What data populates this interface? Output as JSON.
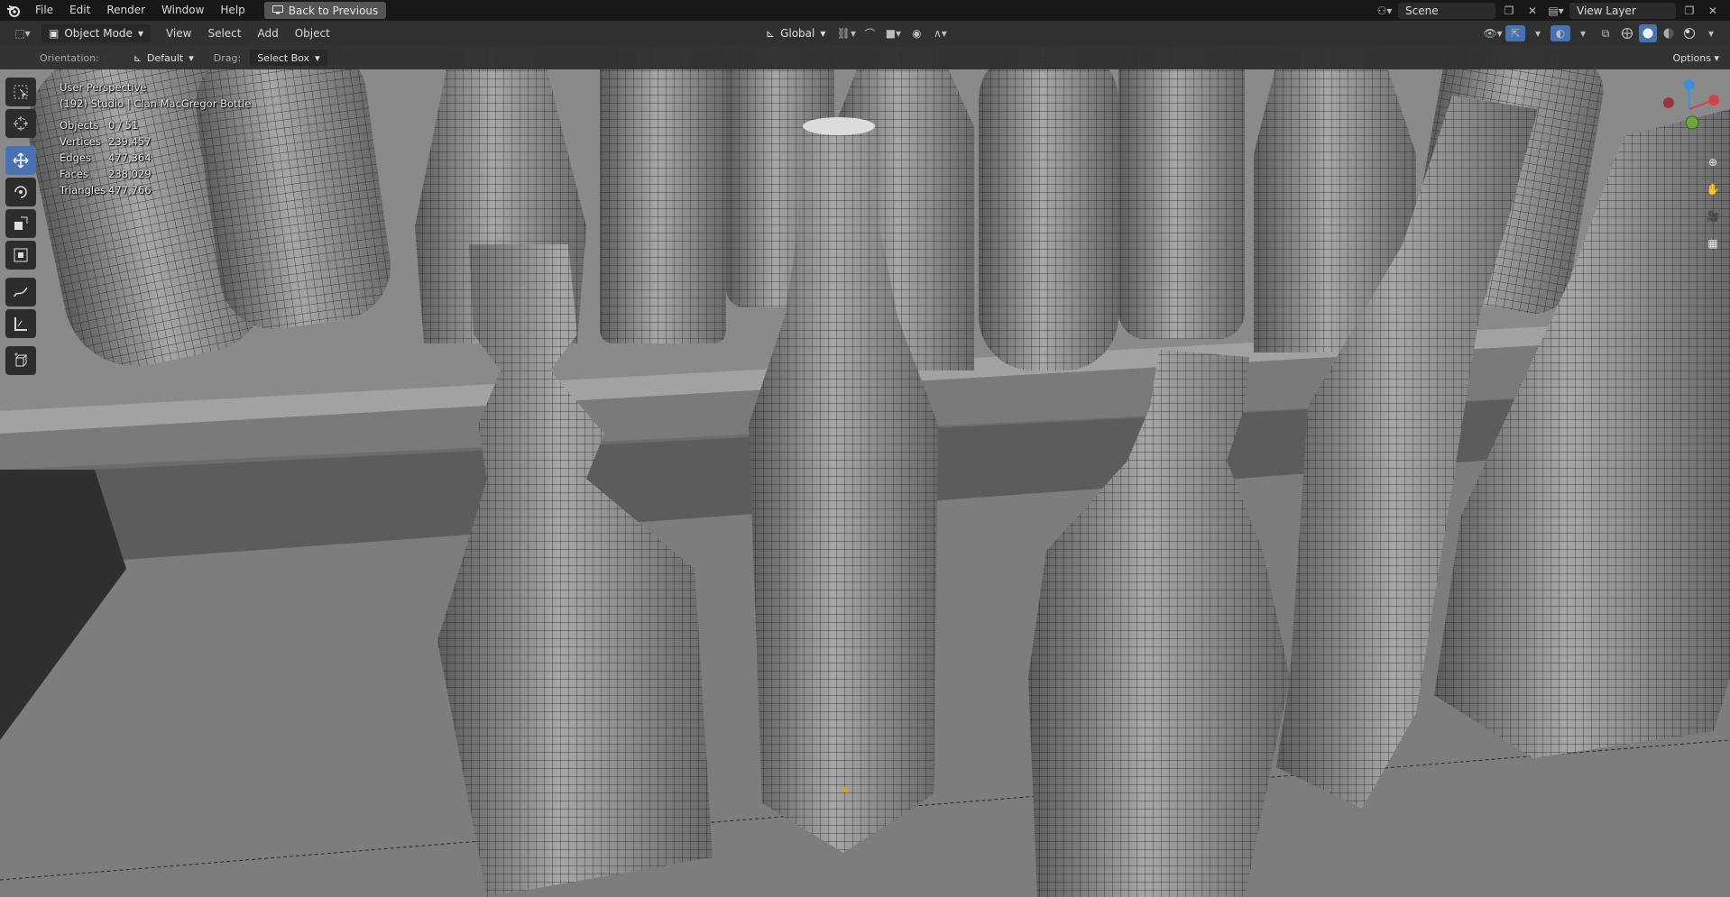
{
  "menubar": {
    "items": [
      "File",
      "Edit",
      "Render",
      "Window",
      "Help"
    ],
    "back_label": "Back to Previous",
    "scene_label": "Scene",
    "view_layer_label": "View Layer"
  },
  "header": {
    "mode_label": "Object Mode",
    "menus": [
      "View",
      "Select",
      "Add",
      "Object"
    ],
    "transform_orientation": "Global"
  },
  "tool_settings": {
    "orientation_label": "Orientation:",
    "orientation_value": "Default",
    "drag_label": "Drag:",
    "drag_value": "Select Box",
    "options_label": "Options"
  },
  "viewport": {
    "view_name": "User Perspective",
    "object_info": "(192) Studio | Clan MacGregor Bottle",
    "stats": [
      {
        "label": "Objects",
        "value": "0 / 51"
      },
      {
        "label": "Vertices",
        "value": "239,457"
      },
      {
        "label": "Edges",
        "value": "477,364"
      },
      {
        "label": "Faces",
        "value": "238,029"
      },
      {
        "label": "Triangles",
        "value": "477,766"
      }
    ]
  },
  "toolbar": {
    "tools": [
      "select-box",
      "cursor",
      "move",
      "rotate",
      "scale",
      "transform",
      "annotate",
      "measure",
      "add-cube"
    ],
    "active_tool": "move"
  },
  "colors": {
    "active_tool": "#4772b3",
    "axis_x": "#d6404d",
    "axis_y": "#6fa53a",
    "axis_z": "#3f8ee0"
  }
}
